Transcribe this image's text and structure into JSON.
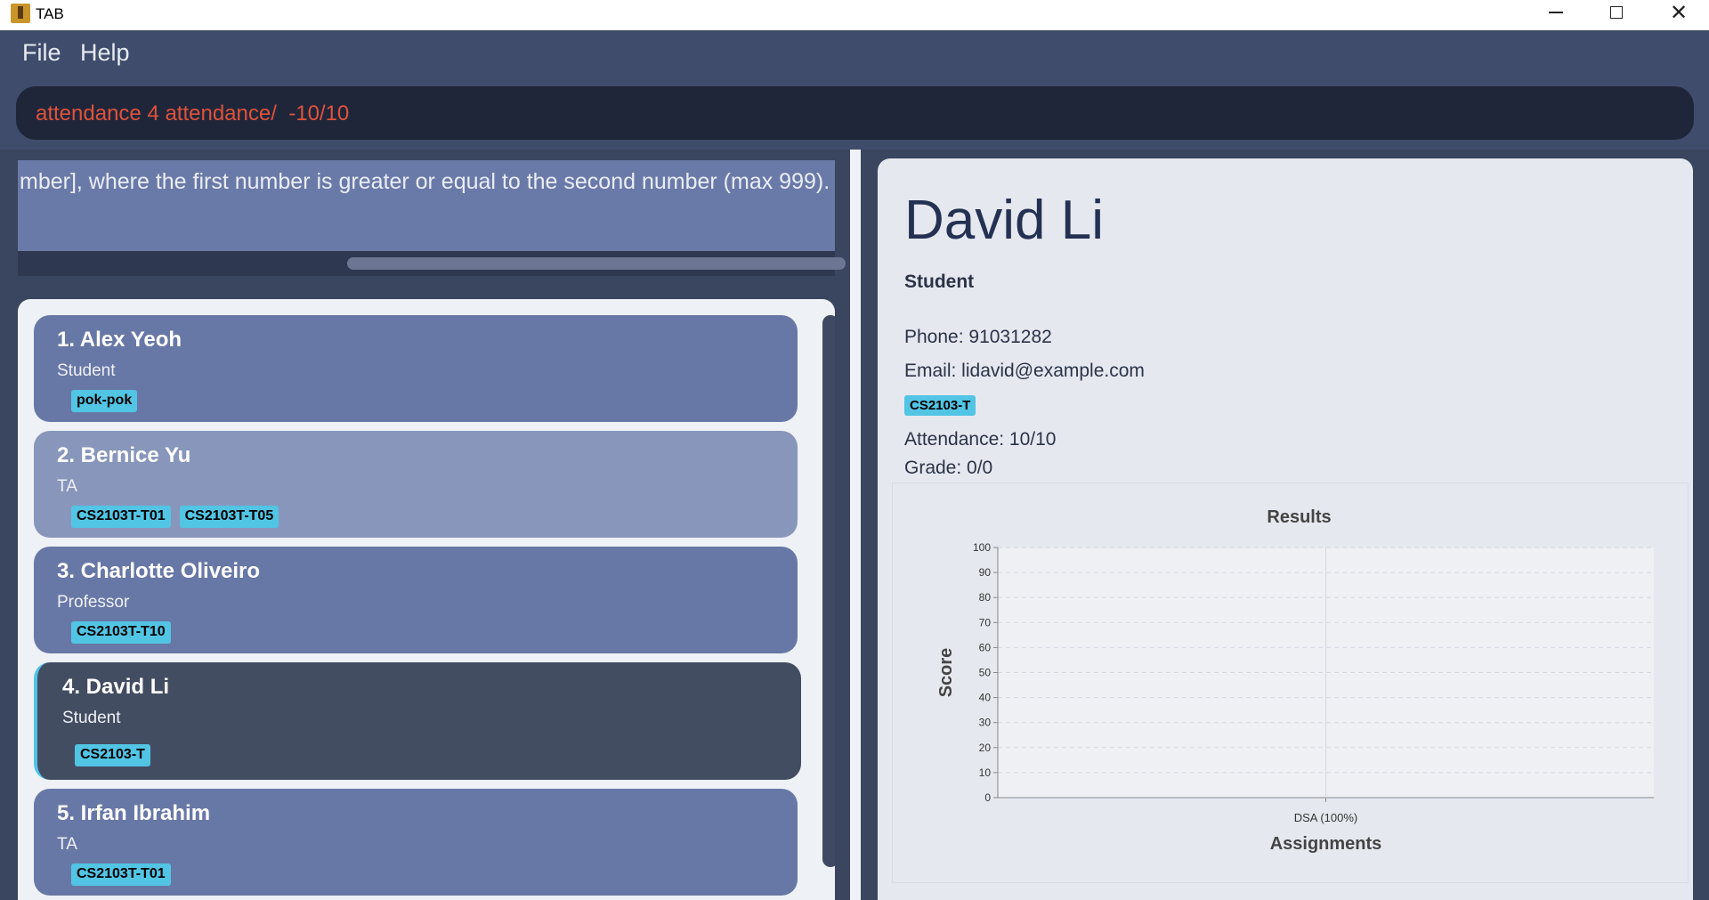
{
  "window": {
    "title": "TAB",
    "icon": "app-logo-icon",
    "controls": [
      "minimize-icon",
      "maximize-icon",
      "close-icon"
    ]
  },
  "menu": {
    "file": "File",
    "help": "Help"
  },
  "command": {
    "value": "attendance 4 attendance/  -10/10",
    "color": "#e0523a"
  },
  "result": {
    "text": "mber], where the first number is greater or equal to the second number (max 999)."
  },
  "persons": [
    {
      "index": "1.",
      "name": "Alex Yeoh",
      "role": "Student",
      "tags": [
        "pok-pok"
      ]
    },
    {
      "index": "2.",
      "name": "Bernice Yu",
      "role": "TA",
      "tags": [
        "CS2103T-T01",
        "CS2103T-T05"
      ]
    },
    {
      "index": "3.",
      "name": "Charlotte Oliveiro",
      "role": "Professor",
      "tags": [
        "CS2103T-T10"
      ]
    },
    {
      "index": "4.",
      "name": "David Li",
      "role": "Student",
      "tags": [
        "CS2103-T"
      ]
    },
    {
      "index": "5.",
      "name": "Irfan Ibrahim",
      "role": "TA",
      "tags": [
        "CS2103T-T01"
      ]
    }
  ],
  "selected_index": 4,
  "detail": {
    "name": "David Li",
    "role": "Student",
    "phone": "Phone: 91031282",
    "email": "Email: lidavid@example.com",
    "tag": "CS2103-T",
    "attendance": "Attendance: 10/10",
    "grade": "Grade: 0/0"
  },
  "colors": {
    "accent": "#52c4e4",
    "card": "#6878a6",
    "card_alt": "#8896bb",
    "card_selected": "#434d61",
    "background": "#3f4c6b"
  },
  "chart_data": {
    "type": "bar",
    "title": "Results",
    "xlabel": "Assignments",
    "ylabel": "Score",
    "categories": [
      "DSA (100%)"
    ],
    "values": [
      0
    ],
    "ylim": [
      0,
      100
    ],
    "yticks": [
      0,
      10,
      20,
      30,
      40,
      50,
      60,
      70,
      80,
      90,
      100
    ],
    "grid": true
  }
}
